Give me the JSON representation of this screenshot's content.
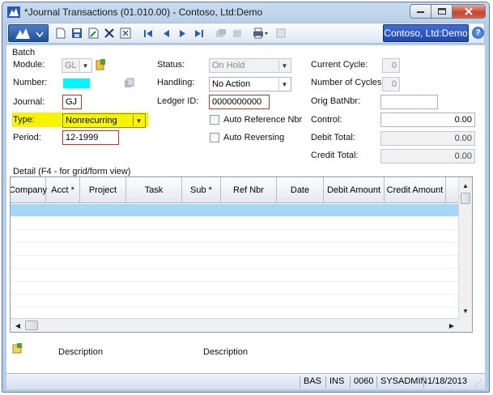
{
  "window": {
    "title": "*Journal Transactions (01.010.00) - Contoso, Ltd:Demo",
    "minimize_icon": "minimize-icon",
    "maximize_icon": "maximize-icon",
    "close_icon": "close-icon"
  },
  "toolbar": {
    "company": "Contoso, Ltd:Demo",
    "help": "?"
  },
  "batch": {
    "section_label": "Batch",
    "module_label": "Module:",
    "module_value": "GL",
    "number_label": "Number:",
    "journal_label": "Journal:",
    "journal_value": "GJ",
    "type_label": "Type:",
    "type_value": "Nonrecurring",
    "period_label": "Period:",
    "period_value": "12-1999",
    "status_label": "Status:",
    "status_value": "On Hold",
    "handling_label": "Handling:",
    "handling_value": "No Action",
    "ledger_label": "Ledger ID:",
    "ledger_value": "0000000000",
    "auto_ref_label": "Auto Reference Nbr",
    "auto_rev_label": "Auto Reversing",
    "current_cycle_label": "Current Cycle:",
    "current_cycle_value": "0",
    "num_cycles_label": "Number of Cycles:",
    "num_cycles_value": "0",
    "orig_batnbr_label": "Orig BatNbr:",
    "orig_batnbr_value": "",
    "control_label": "Control:",
    "control_value": "0.00",
    "debit_total_label": "Debit Total:",
    "debit_total_value": "0.00",
    "credit_total_label": "Credit Total:",
    "credit_total_value": "0.00"
  },
  "detail": {
    "section_label": "Detail (F4 - for grid/form view)",
    "columns": [
      "Company",
      "Acct *",
      "Project",
      "Task",
      "Sub *",
      "Ref Nbr",
      "Date",
      "Debit Amount",
      "Credit Amount"
    ],
    "description_left": "Description",
    "description_right": "Description"
  },
  "status_bar": {
    "mode": "BAS",
    "ins": "INS",
    "code": "0060",
    "user": "SYSADMIN",
    "date": "1/18/2013"
  }
}
